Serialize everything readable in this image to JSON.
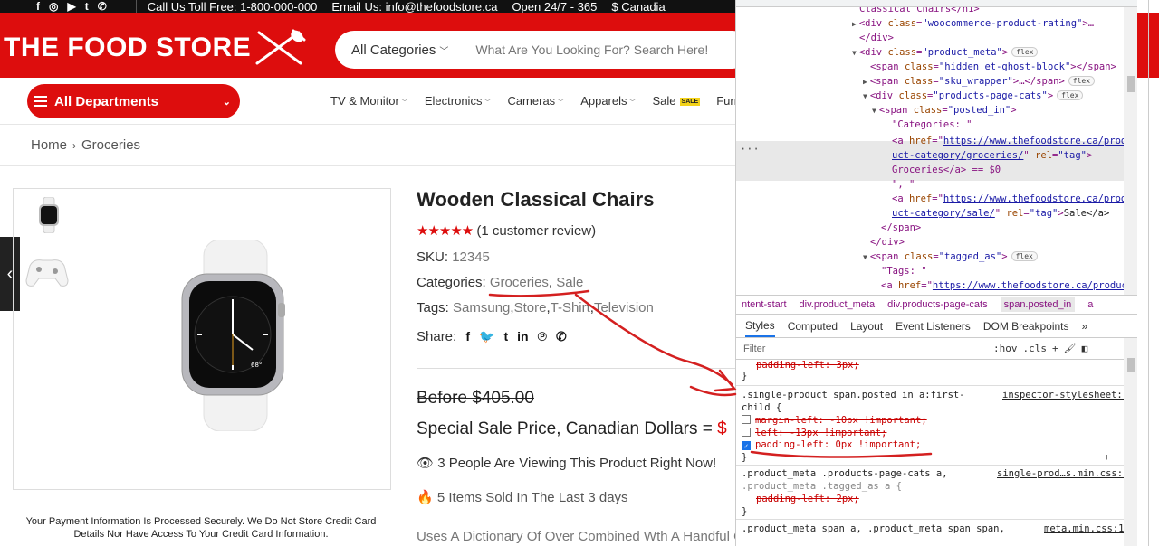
{
  "topbar": {
    "social_icons": [
      "facebook-icon",
      "instagram-icon",
      "youtube-icon",
      "twitter-icon",
      "whatsapp-icon"
    ],
    "phone": "Call Us Toll Free: 1-800-000-000",
    "email": "Email Us: info@thefoodstore.ca",
    "hours": "Open 24/7 - 365",
    "canadian": "$ Canadia"
  },
  "header": {
    "logo": "THE FOOD STORE",
    "search_category": "All Categories",
    "search_placeholder": "What Are You Looking For? Search Here!"
  },
  "nav": {
    "departments": "All Departments",
    "items": [
      "TV & Monitor",
      "Electronics",
      "Cameras",
      "Apparels",
      "Sale",
      "Furn"
    ],
    "sale_badge": "SALE"
  },
  "breadcrumb": {
    "home": "Home",
    "current": "Groceries"
  },
  "product": {
    "title": "Wooden Classical Chairs",
    "stars": "★★★★★",
    "reviews": "(1 customer review)",
    "sku_label": "SKU:",
    "sku": "12345",
    "categories_label": "Categories:",
    "categories": [
      "Groceries",
      "Sale"
    ],
    "tags_label": "Tags:",
    "tags": [
      "Samsung",
      "Store",
      "T-Shirt",
      "Television"
    ],
    "share_label": "Share:",
    "before": "Before $405.00",
    "special": "Special Sale Price, Canadian Dollars =",
    "special_tail": "$",
    "viewing": "3 People Are Viewing This Product Right Now!",
    "sold": "5 Items Sold In The Last 3 days",
    "uses": "Uses A Dictionary Of Over Combined Wth A Handful Of Model",
    "secure": "Your Payment Information Is Processed Securely. We Do Not Store Credit Card Details Nor Have Access To Your Credit Card Information.",
    "watch_time": "68°"
  },
  "devtools": {
    "dom": {
      "l0": "Classical Chairs</h1>",
      "l1_tag": "<div ",
      "l1_attr": "class",
      "l1_val": "\"woocommerce-product-rating\"",
      "l1_tail": ">…",
      "l2": "</div>",
      "l3_tag": "<div ",
      "l3_attr": "class",
      "l3_val": "\"product_meta\"",
      "l3_tail": ">",
      "l4_tag": "<span ",
      "l4_attr": "class",
      "l4_val": "\"hidden et-ghost-block\"",
      "l4_tail": "></span>",
      "l5_tag": "<span ",
      "l5_attr": "class",
      "l5_val": "\"sku_wrapper\"",
      "l5_tail": ">…</span>",
      "l6_tag": "<div ",
      "l6_attr": "class",
      "l6_val": "\"products-page-cats\"",
      "l6_tail": ">",
      "l7_tag": "<span ",
      "l7_attr": "class",
      "l7_val": "\"posted_in\"",
      "l7_tail": ">",
      "l8": "\"Categories: \"",
      "l9_tag": "<a ",
      "l9_attr": "href",
      "l9_val": "https://www.thefoodstore.ca/prod",
      "l10_val": "uct-category/groceries/",
      "l10_attr": "rel",
      "l10_rel": "\"tag\"",
      "l11": "Groceries</a> == $0",
      "l12": "\", \"",
      "l13_val": "https://www.thefoodstore.ca/prod",
      "l14_val": "uct-category/sale/",
      "l14_tail": "Sale</a>",
      "l15": "</span>",
      "l16": "</div>",
      "l17_val": "\"tagged_as\"",
      "l18": "\"Tags: \"",
      "l19_val": "https://www.thefoodstore.ca/produc",
      "flex": "flex"
    },
    "crumbs": [
      "ntent-start",
      "div.product_meta",
      "div.products-page-cats",
      "span.posted_in",
      "a"
    ],
    "panel_tabs": [
      "Styles",
      "Computed",
      "Layout",
      "Event Listeners",
      "DOM Breakpoints",
      "»"
    ],
    "filter_placeholder": "Filter",
    "hov": ":hov",
    "cls": ".cls",
    "styles": {
      "s0": "padding-left: 3px;",
      "s1_sel": ".single-product span.posted_in a:first-",
      "s1_sel2": "child {",
      "s1_src": "inspector-stylesheet:1",
      "s1_p1": "margin-left: -10px !important;",
      "s1_p2": "left: -13px !important;",
      "s1_p3": "padding-left: 0px !important;",
      "close": "}",
      "s2_sel": ".product_meta .products-page-cats a,",
      "s2_src": "single-prod…s.min.css:1",
      "s2_sel2": ".product_meta .tagged_as a {",
      "s2_p1": "padding-left: 2px;",
      "s3_sel": ".product_meta span a, .product_meta span span,",
      "s3_src": "meta.min.css:1"
    }
  },
  "colors": {
    "brand_red": "#dd0d0d",
    "annotation_red": "#d42020"
  }
}
